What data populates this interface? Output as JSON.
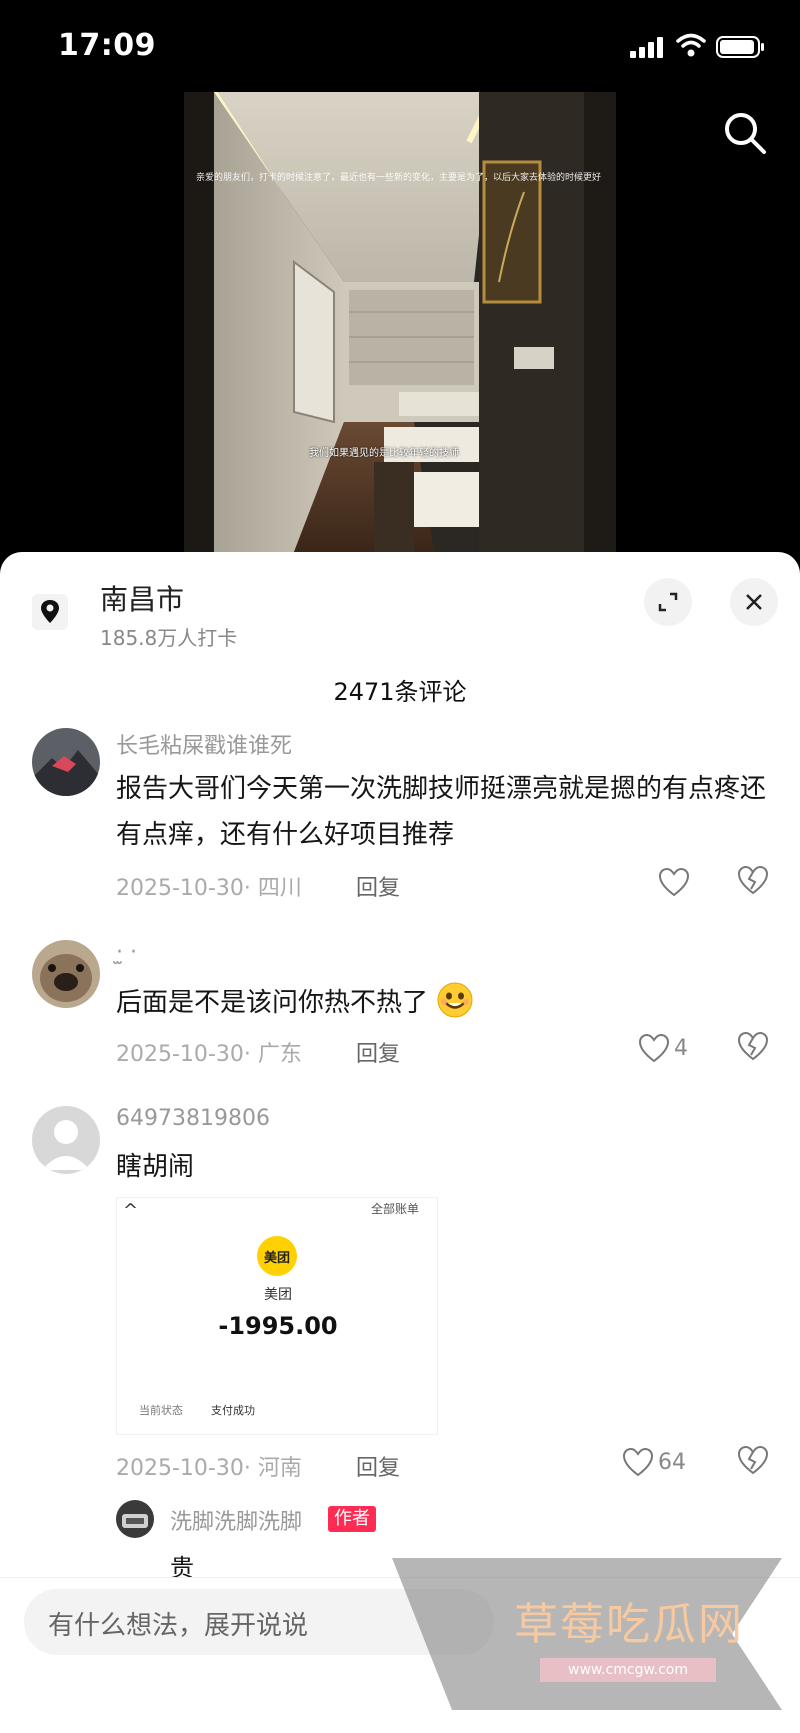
{
  "status_bar": {
    "time": "17:09"
  },
  "video": {
    "caption_top": "亲爱的朋友们，打卡的时候注意了，最近也有一些新的变化，主要是为了，以后大家去体验的时候更好",
    "caption_mid": "我们如果遇见的是比较年轻的技师"
  },
  "location": {
    "city": "南昌市",
    "checkins": "185.8万人打卡"
  },
  "comments_header": {
    "count_label": "2471条评论"
  },
  "comments": [
    {
      "username": "长毛粘屎戳谁谁死",
      "text": "报告大哥们今天第一次洗脚技师挺漂亮就是摁的有点疼还有点痒，还有什么好项目推荐",
      "date_location": "2025-10-30· 四川",
      "reply_label": "回复",
      "likes": ""
    },
    {
      "username": "·̫ ·",
      "text": "后面是不是该问你热不热了",
      "date_location": "2025-10-30· 广东",
      "reply_label": "回复",
      "likes": "4"
    },
    {
      "username": "64973819806",
      "text": "瞎胡闹",
      "date_location": "2025-10-30· 河南",
      "reply_label": "回复",
      "likes": "64"
    }
  ],
  "attachment": {
    "back": "^",
    "top_right": "全部账单",
    "brand": "美团",
    "brand_name": "美团",
    "amount": "-1995.00",
    "status_label": "当前状态",
    "status_value": "支付成功"
  },
  "reply": {
    "username": "洗脚洗脚洗脚",
    "badge": "作者",
    "text": "贵"
  },
  "input": {
    "placeholder": "有什么想法，展开说说"
  },
  "watermark": {
    "text": "草莓吃瓜网",
    "url": "www.cmcgw.com"
  },
  "colors": {
    "author_badge": "#fe2c55",
    "sheet_bg": "#ffffff",
    "meituan": "#ffd100"
  }
}
